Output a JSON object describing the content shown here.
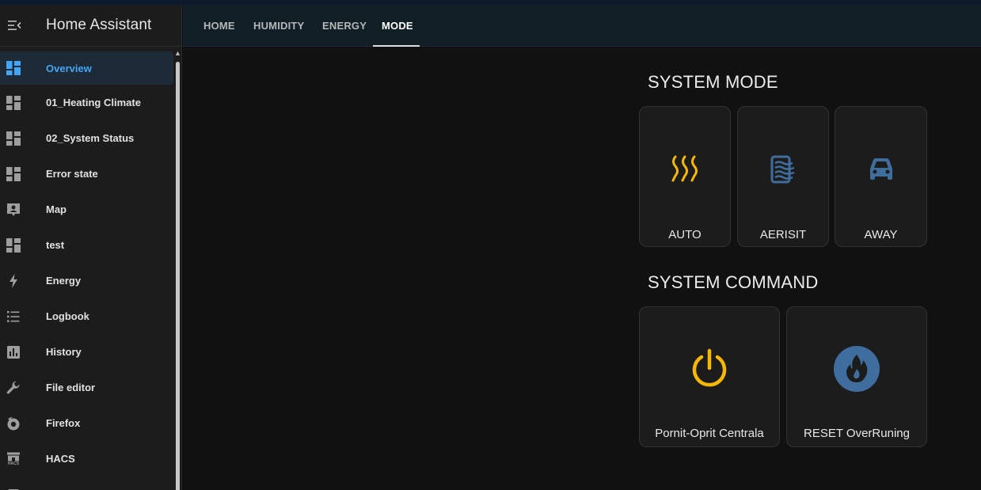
{
  "app": {
    "title": "Home Assistant"
  },
  "sidebar": {
    "items": [
      {
        "label": "Overview",
        "icon": "dashboard-icon",
        "active": true
      },
      {
        "label": "01_Heating Climate",
        "icon": "dashboard-icon"
      },
      {
        "label": "02_System Status",
        "icon": "dashboard-icon"
      },
      {
        "label": "Error state",
        "icon": "dashboard-icon"
      },
      {
        "label": "Map",
        "icon": "map-person-icon"
      },
      {
        "label": "test",
        "icon": "dashboard-icon"
      },
      {
        "label": "Energy",
        "icon": "lightning-icon"
      },
      {
        "label": "Logbook",
        "icon": "list-icon"
      },
      {
        "label": "History",
        "icon": "bar-chart-icon"
      },
      {
        "label": "File editor",
        "icon": "wrench-icon"
      },
      {
        "label": "Firefox",
        "icon": "firefox-icon"
      },
      {
        "label": "HACS",
        "icon": "hacs-icon",
        "icon_text": "HACS"
      }
    ]
  },
  "tabs": [
    {
      "label": "HOME"
    },
    {
      "label": "HUMIDITY"
    },
    {
      "label": "ENERGY"
    },
    {
      "label": "MODE",
      "active": true
    }
  ],
  "sections": {
    "system_mode": {
      "title": "SYSTEM MODE",
      "cards": [
        {
          "label": "AUTO",
          "icon": "radiator-heat-icon",
          "icon_color": "#f5b800"
        },
        {
          "label": "AERISIT",
          "icon": "air-filter-icon",
          "icon_color": "#3f6e9e"
        },
        {
          "label": "AWAY",
          "icon": "car-icon",
          "icon_color": "#3f6e9e"
        }
      ]
    },
    "system_command": {
      "title": "SYSTEM COMMAND",
      "cards": [
        {
          "label": "Pornit-Oprit Centrala",
          "icon": "power-icon",
          "icon_color": "#f5b800"
        },
        {
          "label": "RESET OverRuning",
          "icon": "fire-circle-icon",
          "icon_color": "#3f6e9e"
        }
      ]
    }
  },
  "colors": {
    "accent": "#42a5f5",
    "sidebar_bg": "#1c1c1c",
    "topbar_bg": "#101e26",
    "card_bg": "#1c1c1c"
  }
}
